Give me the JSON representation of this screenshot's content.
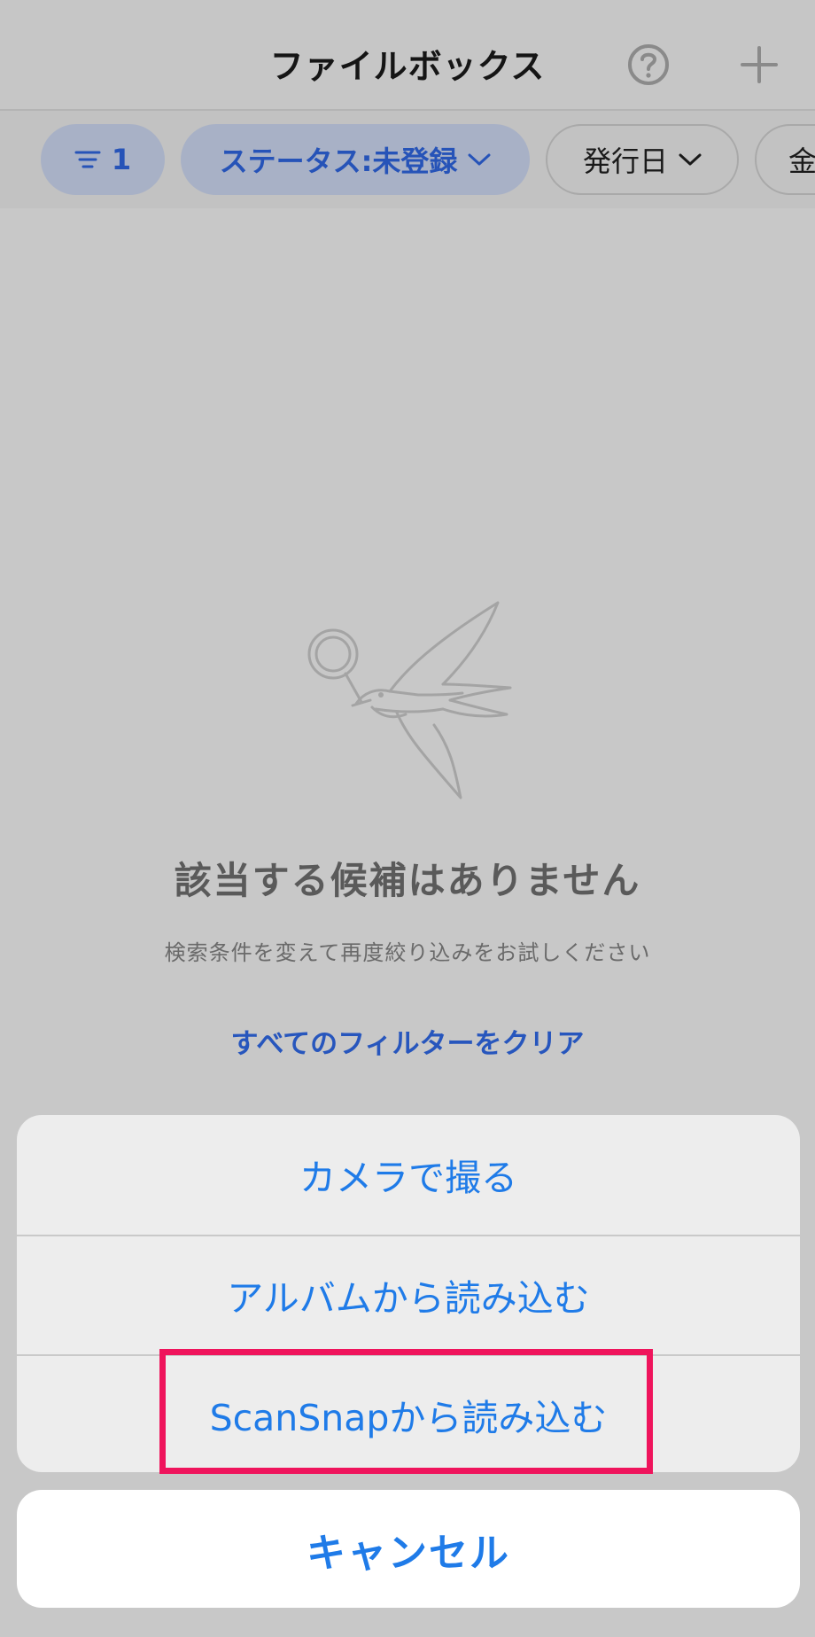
{
  "header": {
    "title": "ファイルボックス"
  },
  "filters": {
    "count": "1",
    "status_label": "ステータス:未登録",
    "date_label": "発行日",
    "amount_label": "金"
  },
  "empty_state": {
    "title": "該当する候補はありません",
    "subtitle": "検索条件を変えて再度絞り込みをお試しください",
    "clear_label": "すべてのフィルターをクリア"
  },
  "action_sheet": {
    "items": [
      {
        "label": "カメラで撮る"
      },
      {
        "label": "アルバムから読み込む"
      },
      {
        "label": "ScanSnapから読み込む"
      }
    ],
    "cancel_label": "キャンセル"
  },
  "colors": {
    "accent": "#1f7be8",
    "filter_accent": "#2653b8",
    "highlight": "#ef145c"
  }
}
